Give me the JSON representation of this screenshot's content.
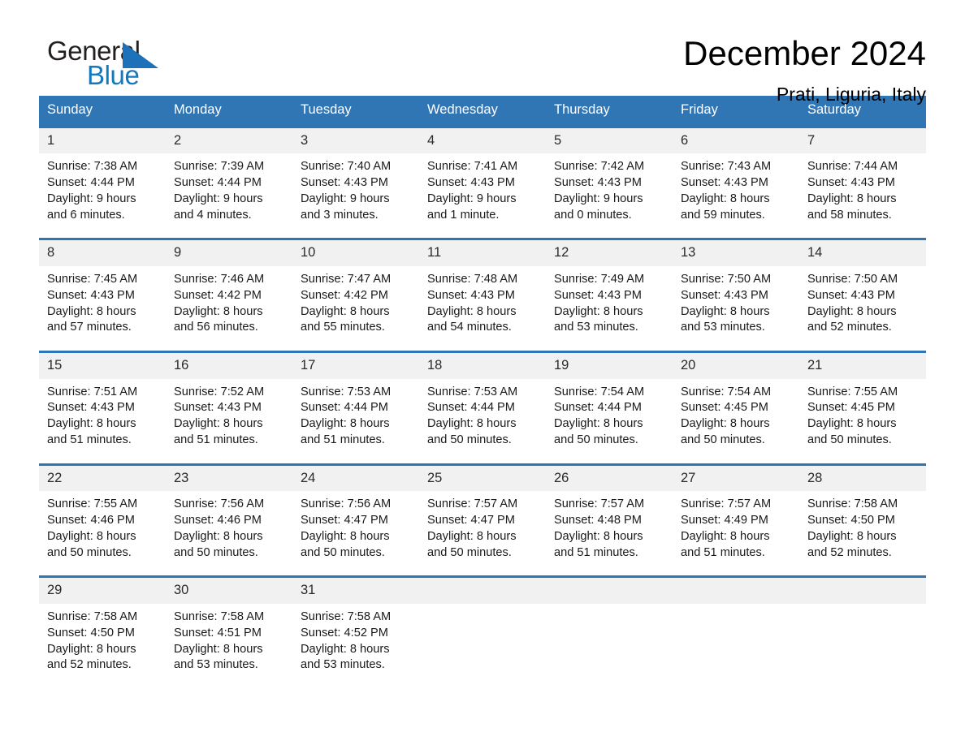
{
  "brand": {
    "name_part1": "General",
    "name_part2": "Blue",
    "accent_color": "#1d71b8"
  },
  "header": {
    "title": "December 2024",
    "subtitle": "Prati, Liguria, Italy"
  },
  "calendar": {
    "header_bg": "#3075b4",
    "separator_color": "#2e75b6",
    "daynum_bg": "#f1f1f1",
    "weekdays": [
      "Sunday",
      "Monday",
      "Tuesday",
      "Wednesday",
      "Thursday",
      "Friday",
      "Saturday"
    ],
    "weeks": [
      [
        {
          "day": "1",
          "sunrise": "Sunrise: 7:38 AM",
          "sunset": "Sunset: 4:44 PM",
          "daylight_line1": "Daylight: 9 hours",
          "daylight_line2": "and 6 minutes."
        },
        {
          "day": "2",
          "sunrise": "Sunrise: 7:39 AM",
          "sunset": "Sunset: 4:44 PM",
          "daylight_line1": "Daylight: 9 hours",
          "daylight_line2": "and 4 minutes."
        },
        {
          "day": "3",
          "sunrise": "Sunrise: 7:40 AM",
          "sunset": "Sunset: 4:43 PM",
          "daylight_line1": "Daylight: 9 hours",
          "daylight_line2": "and 3 minutes."
        },
        {
          "day": "4",
          "sunrise": "Sunrise: 7:41 AM",
          "sunset": "Sunset: 4:43 PM",
          "daylight_line1": "Daylight: 9 hours",
          "daylight_line2": "and 1 minute."
        },
        {
          "day": "5",
          "sunrise": "Sunrise: 7:42 AM",
          "sunset": "Sunset: 4:43 PM",
          "daylight_line1": "Daylight: 9 hours",
          "daylight_line2": "and 0 minutes."
        },
        {
          "day": "6",
          "sunrise": "Sunrise: 7:43 AM",
          "sunset": "Sunset: 4:43 PM",
          "daylight_line1": "Daylight: 8 hours",
          "daylight_line2": "and 59 minutes."
        },
        {
          "day": "7",
          "sunrise": "Sunrise: 7:44 AM",
          "sunset": "Sunset: 4:43 PM",
          "daylight_line1": "Daylight: 8 hours",
          "daylight_line2": "and 58 minutes."
        }
      ],
      [
        {
          "day": "8",
          "sunrise": "Sunrise: 7:45 AM",
          "sunset": "Sunset: 4:43 PM",
          "daylight_line1": "Daylight: 8 hours",
          "daylight_line2": "and 57 minutes."
        },
        {
          "day": "9",
          "sunrise": "Sunrise: 7:46 AM",
          "sunset": "Sunset: 4:42 PM",
          "daylight_line1": "Daylight: 8 hours",
          "daylight_line2": "and 56 minutes."
        },
        {
          "day": "10",
          "sunrise": "Sunrise: 7:47 AM",
          "sunset": "Sunset: 4:42 PM",
          "daylight_line1": "Daylight: 8 hours",
          "daylight_line2": "and 55 minutes."
        },
        {
          "day": "11",
          "sunrise": "Sunrise: 7:48 AM",
          "sunset": "Sunset: 4:43 PM",
          "daylight_line1": "Daylight: 8 hours",
          "daylight_line2": "and 54 minutes."
        },
        {
          "day": "12",
          "sunrise": "Sunrise: 7:49 AM",
          "sunset": "Sunset: 4:43 PM",
          "daylight_line1": "Daylight: 8 hours",
          "daylight_line2": "and 53 minutes."
        },
        {
          "day": "13",
          "sunrise": "Sunrise: 7:50 AM",
          "sunset": "Sunset: 4:43 PM",
          "daylight_line1": "Daylight: 8 hours",
          "daylight_line2": "and 53 minutes."
        },
        {
          "day": "14",
          "sunrise": "Sunrise: 7:50 AM",
          "sunset": "Sunset: 4:43 PM",
          "daylight_line1": "Daylight: 8 hours",
          "daylight_line2": "and 52 minutes."
        }
      ],
      [
        {
          "day": "15",
          "sunrise": "Sunrise: 7:51 AM",
          "sunset": "Sunset: 4:43 PM",
          "daylight_line1": "Daylight: 8 hours",
          "daylight_line2": "and 51 minutes."
        },
        {
          "day": "16",
          "sunrise": "Sunrise: 7:52 AM",
          "sunset": "Sunset: 4:43 PM",
          "daylight_line1": "Daylight: 8 hours",
          "daylight_line2": "and 51 minutes."
        },
        {
          "day": "17",
          "sunrise": "Sunrise: 7:53 AM",
          "sunset": "Sunset: 4:44 PM",
          "daylight_line1": "Daylight: 8 hours",
          "daylight_line2": "and 51 minutes."
        },
        {
          "day": "18",
          "sunrise": "Sunrise: 7:53 AM",
          "sunset": "Sunset: 4:44 PM",
          "daylight_line1": "Daylight: 8 hours",
          "daylight_line2": "and 50 minutes."
        },
        {
          "day": "19",
          "sunrise": "Sunrise: 7:54 AM",
          "sunset": "Sunset: 4:44 PM",
          "daylight_line1": "Daylight: 8 hours",
          "daylight_line2": "and 50 minutes."
        },
        {
          "day": "20",
          "sunrise": "Sunrise: 7:54 AM",
          "sunset": "Sunset: 4:45 PM",
          "daylight_line1": "Daylight: 8 hours",
          "daylight_line2": "and 50 minutes."
        },
        {
          "day": "21",
          "sunrise": "Sunrise: 7:55 AM",
          "sunset": "Sunset: 4:45 PM",
          "daylight_line1": "Daylight: 8 hours",
          "daylight_line2": "and 50 minutes."
        }
      ],
      [
        {
          "day": "22",
          "sunrise": "Sunrise: 7:55 AM",
          "sunset": "Sunset: 4:46 PM",
          "daylight_line1": "Daylight: 8 hours",
          "daylight_line2": "and 50 minutes."
        },
        {
          "day": "23",
          "sunrise": "Sunrise: 7:56 AM",
          "sunset": "Sunset: 4:46 PM",
          "daylight_line1": "Daylight: 8 hours",
          "daylight_line2": "and 50 minutes."
        },
        {
          "day": "24",
          "sunrise": "Sunrise: 7:56 AM",
          "sunset": "Sunset: 4:47 PM",
          "daylight_line1": "Daylight: 8 hours",
          "daylight_line2": "and 50 minutes."
        },
        {
          "day": "25",
          "sunrise": "Sunrise: 7:57 AM",
          "sunset": "Sunset: 4:47 PM",
          "daylight_line1": "Daylight: 8 hours",
          "daylight_line2": "and 50 minutes."
        },
        {
          "day": "26",
          "sunrise": "Sunrise: 7:57 AM",
          "sunset": "Sunset: 4:48 PM",
          "daylight_line1": "Daylight: 8 hours",
          "daylight_line2": "and 51 minutes."
        },
        {
          "day": "27",
          "sunrise": "Sunrise: 7:57 AM",
          "sunset": "Sunset: 4:49 PM",
          "daylight_line1": "Daylight: 8 hours",
          "daylight_line2": "and 51 minutes."
        },
        {
          "day": "28",
          "sunrise": "Sunrise: 7:58 AM",
          "sunset": "Sunset: 4:50 PM",
          "daylight_line1": "Daylight: 8 hours",
          "daylight_line2": "and 52 minutes."
        }
      ],
      [
        {
          "day": "29",
          "sunrise": "Sunrise: 7:58 AM",
          "sunset": "Sunset: 4:50 PM",
          "daylight_line1": "Daylight: 8 hours",
          "daylight_line2": "and 52 minutes."
        },
        {
          "day": "30",
          "sunrise": "Sunrise: 7:58 AM",
          "sunset": "Sunset: 4:51 PM",
          "daylight_line1": "Daylight: 8 hours",
          "daylight_line2": "and 53 minutes."
        },
        {
          "day": "31",
          "sunrise": "Sunrise: 7:58 AM",
          "sunset": "Sunset: 4:52 PM",
          "daylight_line1": "Daylight: 8 hours",
          "daylight_line2": "and 53 minutes."
        },
        {
          "day": "",
          "sunrise": "",
          "sunset": "",
          "daylight_line1": "",
          "daylight_line2": ""
        },
        {
          "day": "",
          "sunrise": "",
          "sunset": "",
          "daylight_line1": "",
          "daylight_line2": ""
        },
        {
          "day": "",
          "sunrise": "",
          "sunset": "",
          "daylight_line1": "",
          "daylight_line2": ""
        },
        {
          "day": "",
          "sunrise": "",
          "sunset": "",
          "daylight_line1": "",
          "daylight_line2": ""
        }
      ]
    ]
  }
}
